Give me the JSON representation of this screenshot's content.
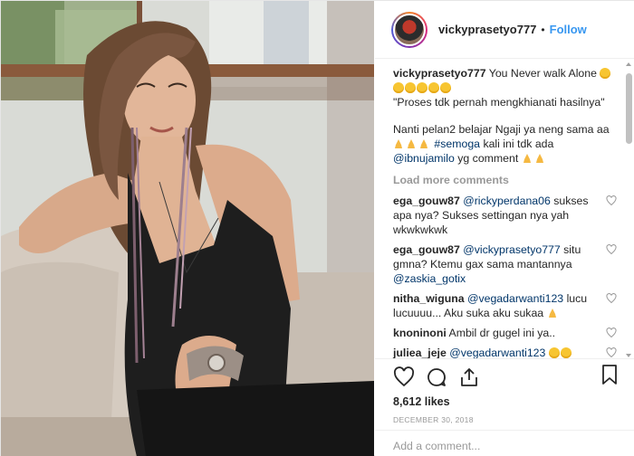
{
  "post": {
    "username": "vickyprasetyo777",
    "separator": "•",
    "follow_label": "Follow",
    "photo_alt": "Photo of a woman in a black halter top with long earrings seated on a sofa",
    "caption": {
      "author": "vickyprasetyo777",
      "line1": "You Never walk Alone",
      "line2": "\"Proses tdk pernah mengkhianati hasilnya\"",
      "line3": "Nanti pelan2 belajar Ngaji ya neng sama aa",
      "tag": "#semoga",
      "line4_suffix": "kali ini tdk ada",
      "mention": "@ibnujamilo",
      "line5_suffix": "yg comment"
    },
    "load_more_label": "Load more comments",
    "comments": [
      {
        "user": "ega_gouw87",
        "mention": "@rickyperdana06",
        "text": "sukses apa nya? Sukses settingan nya yah wkwkwkwk"
      },
      {
        "user": "ega_gouw87",
        "mention": "@vickyprasetyo777",
        "text": "situ gmna? Ktemu gax sama mantannya",
        "mention2": "@zaskia_gotix"
      },
      {
        "user": "nitha_wiguna",
        "mention": "@vegadarwanti123",
        "text": "lucu lucuuuu... Aku suka aku sukaa"
      },
      {
        "user": "knoninoni",
        "mention": "",
        "text": "Ambil dr gugel ini ya.."
      },
      {
        "user": "juliea_jeje",
        "mention": "@vegadarwanti123",
        "text": ""
      }
    ],
    "likes": "8,612 likes",
    "date": "December 30, 2018",
    "add_comment_placeholder": "Add a comment..."
  },
  "icons": {
    "like": "heart-outline-icon",
    "comment": "speech-bubble-icon",
    "share": "share-icon",
    "save": "bookmark-icon",
    "comment_like": "small-heart-icon"
  },
  "colors": {
    "link": "#3897f0",
    "mention": "#003569",
    "muted": "#999999",
    "text": "#262626"
  }
}
